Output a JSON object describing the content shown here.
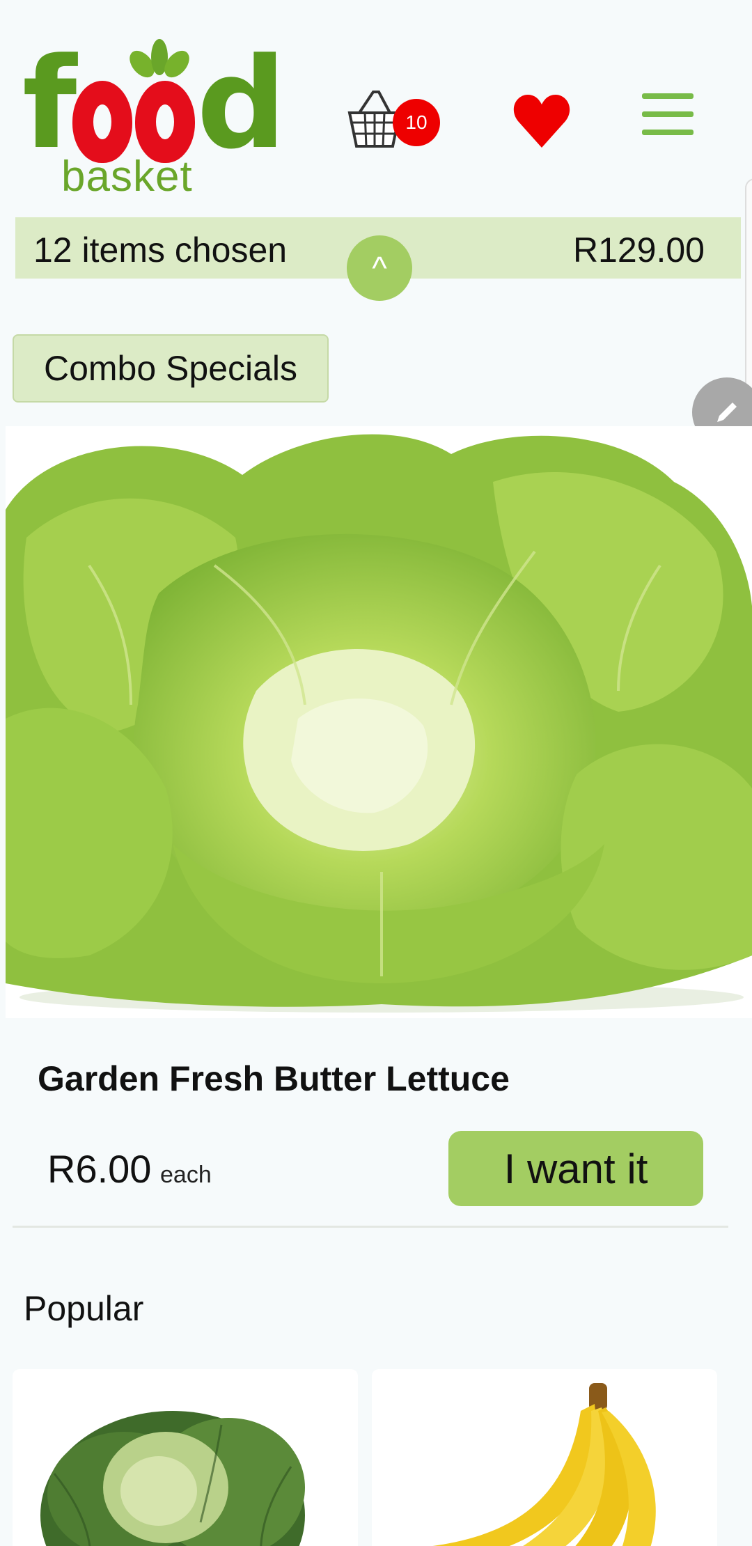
{
  "header": {
    "logo_word": "food",
    "logo_sub": "basket",
    "cart_count": "10",
    "icons": {
      "cart": "shopping-basket-icon",
      "favorites": "heart-icon",
      "menu": "hamburger-menu-icon"
    }
  },
  "summary": {
    "items_text": "12 items chosen",
    "total": "R129.00",
    "expand_glyph": "^"
  },
  "category_button": "Combo Specials",
  "product": {
    "image": "butter-lettuce-photo",
    "name": "Garden Fresh Butter Lettuce",
    "price": "R6.00",
    "unit": "each",
    "cta": "I want it"
  },
  "popular": {
    "heading": "Popular",
    "cards": [
      {
        "image": "savoy-cabbage-photo"
      },
      {
        "image": "bananas-photo"
      }
    ]
  },
  "colors": {
    "brand_green": "#5a9a1f",
    "brand_red": "#e40d1b",
    "button_green": "#a3cd62",
    "bar_green": "#dcebc6",
    "badge_red": "#ee0000"
  }
}
